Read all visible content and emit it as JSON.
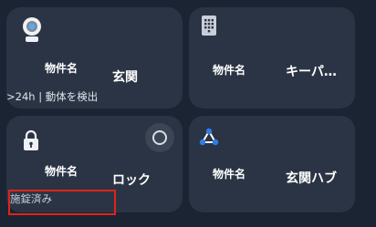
{
  "tiles": [
    {
      "name": "物件名",
      "value": "玄関",
      "status": ">24h | 動体を検出",
      "icon": "motion-sensor-icon"
    },
    {
      "name": "物件名",
      "value": "キーパ…",
      "icon": "keypad-icon"
    },
    {
      "name": "物件名",
      "value": "ロック",
      "status": "施錠済み",
      "icon": "lock-icon",
      "toggle_icon": "circle-toggle-icon"
    },
    {
      "name": "物件名",
      "value": "玄関ハブ",
      "icon": "hub-icon"
    }
  ],
  "colors": {
    "background": "#1b2432",
    "tile": "#2a3444",
    "hub_accent": "#2f7de8",
    "highlight": "#e2231a"
  }
}
